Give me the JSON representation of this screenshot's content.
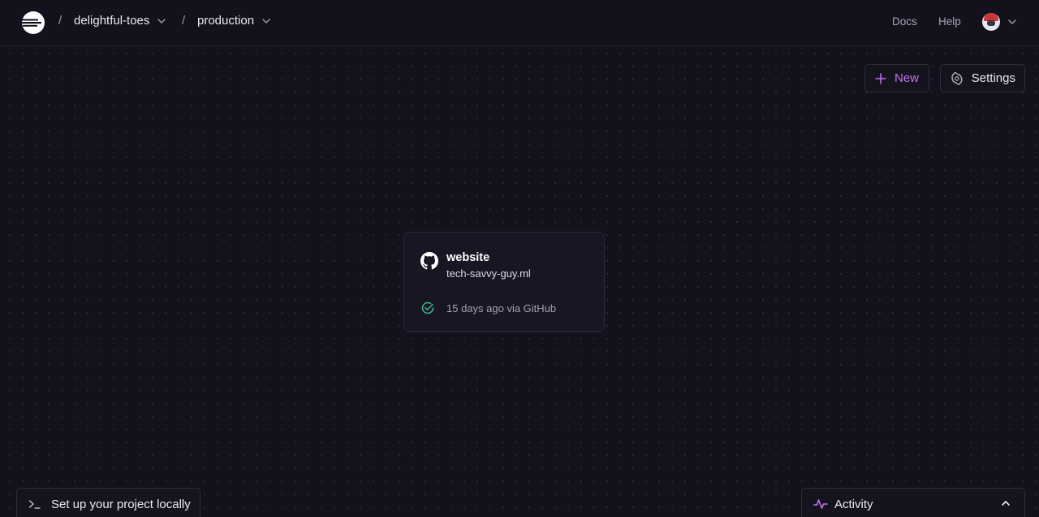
{
  "header": {
    "project_name": "delightful-toes",
    "environment": "production",
    "separator": "/",
    "docs_label": "Docs",
    "help_label": "Help"
  },
  "actions": {
    "new_label": "New",
    "settings_label": "Settings"
  },
  "service_card": {
    "name": "website",
    "domain": "tech-savvy-guy.ml",
    "deploy_status": "15 days ago via GitHub",
    "icon": "github-icon",
    "status_icon": "check-circle-icon"
  },
  "footer": {
    "local_setup_label": "Set up your project locally",
    "activity_label": "Activity"
  },
  "colors": {
    "background": "#13111c",
    "accent": "#c074f5",
    "success": "#3fb989"
  }
}
